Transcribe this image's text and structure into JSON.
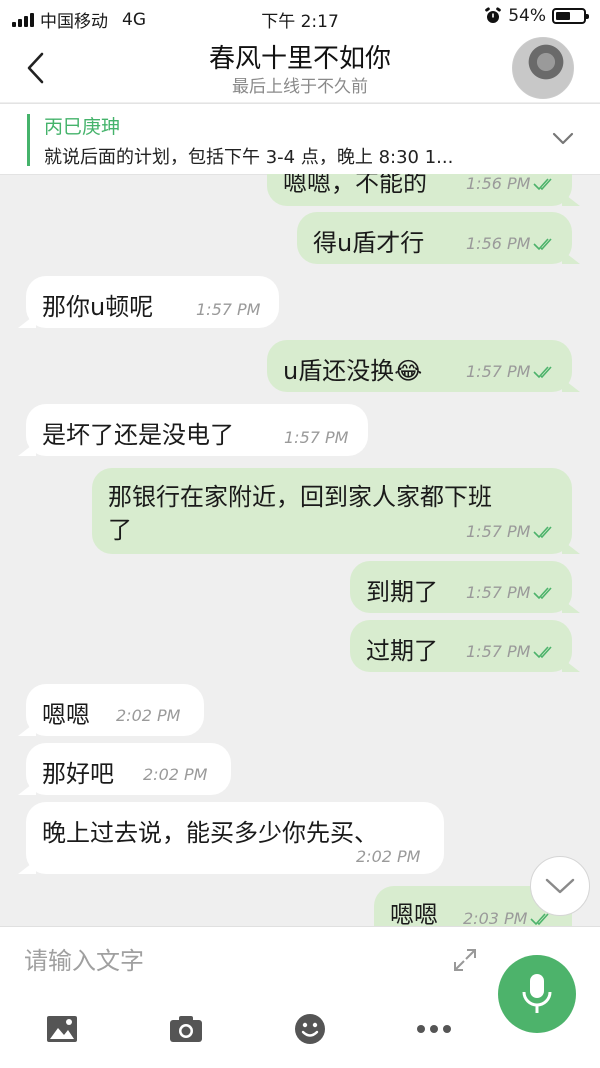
{
  "status_bar": {
    "carrier": "中国移动",
    "network": "4G",
    "time": "下午 2:17",
    "battery_percent": 54,
    "battery_label": "54%"
  },
  "header": {
    "title": "春风十里不如你",
    "subtitle": "最后上线于不久前"
  },
  "pinned": {
    "title": "丙巳庚珅",
    "text": "就说后面的计划，包括下午 3-4 点，晚上 8:30  1..."
  },
  "messages": [
    {
      "direction": "out",
      "text": "嗯嗯，不能的",
      "time": "1:56 PM"
    },
    {
      "direction": "out",
      "text": "得u盾才行",
      "time": "1:56 PM"
    },
    {
      "direction": "in",
      "text": "那你u顿呢",
      "time": "1:57 PM"
    },
    {
      "direction": "out",
      "text": "u盾还没换😂",
      "time": "1:57 PM"
    },
    {
      "direction": "in",
      "text": "是坏了还是没电了",
      "time": "1:57 PM"
    },
    {
      "direction": "out",
      "text": "那银行在家附近，回到家人家都下班",
      "text2": "了",
      "time": "1:57 PM"
    },
    {
      "direction": "out",
      "text": "到期了",
      "time": "1:57 PM"
    },
    {
      "direction": "out",
      "text": "过期了",
      "time": "1:57 PM"
    },
    {
      "direction": "in",
      "text": "嗯嗯",
      "time": "2:02 PM"
    },
    {
      "direction": "in",
      "text": "那好吧",
      "time": "2:02 PM"
    },
    {
      "direction": "in",
      "text": "晚上过去说，能买多少你先买、",
      "time": "2:02 PM"
    },
    {
      "direction": "out",
      "text": "嗯嗯",
      "time": "2:03 PM"
    }
  ],
  "input": {
    "placeholder": "请输入文字"
  },
  "icons": {
    "back": "back-chevron-icon",
    "pin_expand": "chevron-down-icon",
    "scroll_down": "chevron-down-icon",
    "expand": "expand-arrows-icon",
    "mic": "microphone-icon",
    "tools": [
      "image-icon",
      "camera-icon",
      "emoji-icon",
      "more-icon"
    ]
  },
  "colors": {
    "accent": "#4db36b",
    "outgoing_bubble": "#d8eccf",
    "incoming_bubble": "#ffffff",
    "background": "#efefef"
  }
}
